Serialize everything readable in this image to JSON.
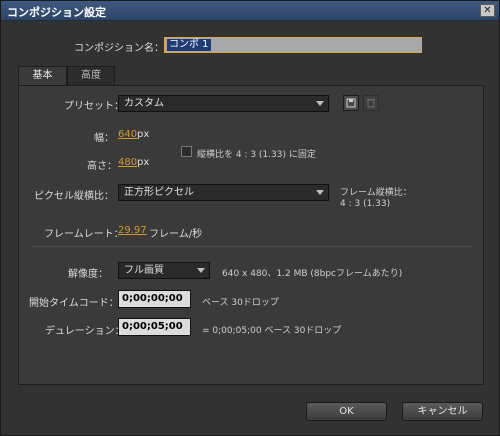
{
  "window": {
    "title": "コンポジション設定"
  },
  "comp_name": {
    "label": "コンポジション名：",
    "value": "コンポ 1"
  },
  "tabs": [
    {
      "label": "基本"
    },
    {
      "label": "高度"
    }
  ],
  "preset": {
    "label": "プリセット：",
    "value": "カスタム"
  },
  "width": {
    "label": "幅：",
    "value": "640",
    "unit": "px"
  },
  "height": {
    "label": "高さ：",
    "value": "480",
    "unit": "px"
  },
  "lock_aspect": {
    "label": "縦横比を 4 : 3 (1.33) に固定",
    "checked": false
  },
  "pixel_aspect": {
    "label": "ピクセル縦横比：",
    "value": "正方形ピクセル"
  },
  "frame_aspect": {
    "label": "フレーム縦横比：",
    "value": "4 : 3 (1.33)"
  },
  "frame_rate": {
    "label": "フレームレート：",
    "value": "29.97",
    "unit": "フレーム/秒"
  },
  "resolution": {
    "label": "解像度：",
    "value": "フル画質",
    "info": "640 x 480、1.2 MB (8bpcフレームあたり)"
  },
  "start_timecode": {
    "label": "開始タイムコード：",
    "value": "0;00;00;00",
    "note": "ベース 30ドロップ"
  },
  "duration": {
    "label": "デュレーション：",
    "value": "0;00;05;00",
    "note": "= 0;00;05;00  ベース 30ドロップ"
  },
  "buttons": {
    "ok": "OK",
    "cancel": "キャンセル"
  },
  "colors": {
    "accent_value": "#d49a2c",
    "title_bar": "#2c4466",
    "focus_border": "#e0a642"
  }
}
